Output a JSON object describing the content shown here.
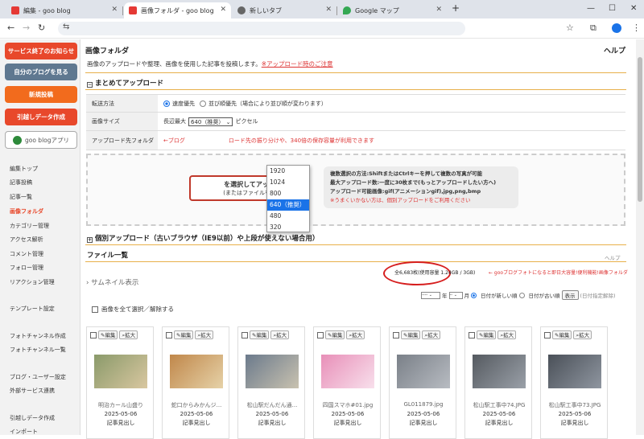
{
  "browser": {
    "tabs": [
      {
        "label": "編集 - goo blog",
        "color": "#e53935"
      },
      {
        "label": "画像フォルダ - goo blog",
        "color": "#e53935"
      },
      {
        "label": "新しいタブ",
        "color": "#666666"
      },
      {
        "label": "Google マップ",
        "color": "#34a853"
      }
    ],
    "new_tab": "+",
    "window_controls": [
      "—",
      "☐",
      "✕"
    ],
    "nav": [
      "←",
      "→",
      "↻",
      "⇆"
    ],
    "icons": [
      "☆",
      "⧉",
      "●",
      "⋮"
    ]
  },
  "sidebar": {
    "buttons": [
      {
        "label": "サービス終了のお知らせ",
        "color": "#e8482b"
      },
      {
        "label": "自分のブログを見る",
        "color": "#5f7890"
      },
      {
        "label": "新規投稿",
        "color": "#f26b1d"
      },
      {
        "label": "引越しデータ作成",
        "color": "#e8482b"
      }
    ],
    "app_label": "goo blogアプリ",
    "nav": [
      "編集トップ",
      "記事投稿",
      "記事一覧",
      "画像フォルダ",
      "カテゴリー管理",
      "アクセス解析",
      "コメント管理",
      "フォロー管理",
      "リアクション管理",
      "テンプレート設定",
      "フォトチャンネル作成",
      "フォトチャンネル一覧",
      "ブログ・ユーザー設定",
      "外部サービス連携",
      "引越しデータ作成",
      "インポート"
    ],
    "active": "画像フォルダ"
  },
  "main": {
    "title": "画像フォルダ",
    "help": "ヘルプ",
    "desc": "画像のアップロードや整理、画像を使用した記事を投稿します。",
    "desc_link": "※アップロード時のご注意",
    "bulk_section": "まとめてアップロード",
    "transfer_label": "転送方法",
    "transfer_opt1": "速度優先",
    "transfer_opt2": "並び順優先（場合により並び順が変わります）",
    "size_label": "画像サイズ",
    "size_prefix": "長辺最大",
    "size_value": "640（推奨）",
    "size_unit": "ピクセル",
    "size_options": [
      "1920",
      "1024",
      "800",
      "640（推奨）",
      "480",
      "320"
    ],
    "folder_label": "アップロード先フォルダ",
    "folder_text_a": "←ブログ",
    "folder_text_b": "ロード先の振り分けや、340倍の保存容量が利用できます",
    "upload_button_line1": "を選択してアップロード",
    "upload_button_line2": "(またはファイルをドロップ)",
    "tip_lines": [
      "複数選択の方法:ShiftまたはCtrlキーを押して複数の写真が可能",
      "最大アップロード数:一度に30枚まで(もっとアップロードしたい方へ)",
      "アップロード可能画像:gif(アニメーションgif),jpg,png,bmp",
      "※うまくいかない方は、個別アップロードをご利用ください"
    ],
    "single_section": "個別アップロード（古いブラウザ（IE9以前）や上段が使えない場合用）",
    "files_title": "ファイル一覧",
    "files_help": "ヘルプ",
    "count_text": "全6,683枚(使用容量 1.24GB / 3GB)",
    "count_link": "← gooブログフォトになると即日大容量!便利機能!画像フォルダ",
    "thumb_toggle": "› サムネイル表示",
    "year_label": "年",
    "month_label": "月",
    "sort_new": "日付が新しい順",
    "sort_old": "日付が古い順",
    "display_button": "表示",
    "date_clear": "(日付指定解除)",
    "select_all": "画像を全て選択／解除する",
    "edit_label": "編集",
    "zoom_label": "拡大",
    "files": [
      {
        "name": "明治カール山盛り",
        "date": "2025-05-06",
        "article": "記事見出し",
        "c1": "#8a9a6a",
        "c2": "#d9c7a0"
      },
      {
        "name": "蛇口からみかんジ...",
        "date": "2025-05-06",
        "article": "記事見出し",
        "c1": "#c0874a",
        "c2": "#e6d2a8"
      },
      {
        "name": "松山駅だんだん通...",
        "date": "2025-05-06",
        "article": "記事見出し",
        "c1": "#6b7a8c",
        "c2": "#c9c2b0"
      },
      {
        "name": "四国スマホ#01.jpg",
        "date": "2025-05-06",
        "article": "記事見出し",
        "c1": "#e88fb8",
        "c2": "#f8e0ec"
      },
      {
        "name": "GL011879.jpg",
        "date": "2025-05-06",
        "article": "記事見出し",
        "c1": "#7a8088",
        "c2": "#b8bcc2"
      },
      {
        "name": "松山駅工事中74.JPG",
        "date": "2025-05-06",
        "article": "記事見出し",
        "c1": "#555a60",
        "c2": "#9aa0a8"
      },
      {
        "name": "松山駅工事中73.JPG",
        "date": "2025-05-06",
        "article": "記事見出し",
        "c1": "#4a5058",
        "c2": "#8f96a0"
      }
    ]
  }
}
